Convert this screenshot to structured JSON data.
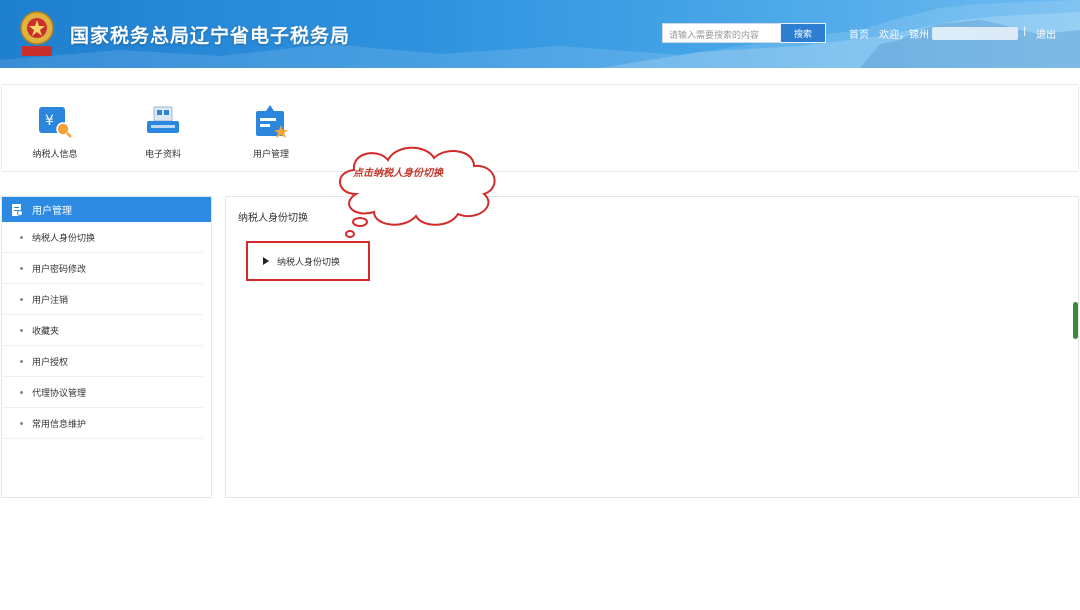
{
  "header": {
    "site_title": "国家税务总局辽宁省电子税务局",
    "search_placeholder": "请输入需要搜索的内容",
    "search_button": "搜索",
    "nav_home": "首页",
    "nav_welcome": "欢迎，锦州",
    "nav_separator": "|",
    "nav_logout": "退出"
  },
  "shortcuts": [
    {
      "label": "纳税人信息",
      "icon": "taxpayer-info-icon"
    },
    {
      "label": "电子资料",
      "icon": "electronic-data-icon"
    },
    {
      "label": "用户管理",
      "icon": "user-management-icon"
    }
  ],
  "sidebar": {
    "title": "用户管理",
    "items": [
      {
        "label": "纳税人身份切换"
      },
      {
        "label": "用户密码修改"
      },
      {
        "label": "用户注销"
      },
      {
        "label": "收藏夹"
      },
      {
        "label": "用户授权"
      },
      {
        "label": "代理协议管理"
      },
      {
        "label": "常用信息维护"
      }
    ]
  },
  "main": {
    "title": "纳税人身份切换",
    "switch_link": "纳税人身份切换"
  },
  "callout": {
    "text": "点击纳税人身份切换"
  },
  "colors": {
    "header_blue": "#2f93df",
    "sidebar_head": "#2d8ae3",
    "highlight_red": "#d32a2a"
  }
}
